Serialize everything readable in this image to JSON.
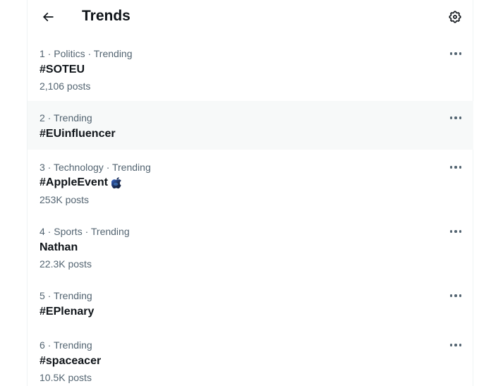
{
  "header": {
    "title": "Trends",
    "back_icon": "arrow-left-icon",
    "settings_icon": "gear-icon"
  },
  "trends": [
    {
      "rank_context": "1 · Politics · Trending",
      "name": "#SOTEU",
      "posts": "2,106 posts"
    },
    {
      "rank_context": "2 · Trending",
      "name": "#EUinfluencer",
      "posts": ""
    },
    {
      "rank_context": "3 · Technology · Trending",
      "name": "#AppleEvent",
      "posts": "253K posts",
      "emoji_icon": "apple-event-icon"
    },
    {
      "rank_context": "4 · Sports · Trending",
      "name": "Nathan",
      "posts": "22.3K posts"
    },
    {
      "rank_context": "5 · Trending",
      "name": "#EPlenary",
      "posts": ""
    },
    {
      "rank_context": "6 · Trending",
      "name": "#spaceacer",
      "posts": "10.5K posts"
    }
  ],
  "more_icon": "more-horizontal-icon",
  "colors": {
    "text_primary": "#0f1419",
    "text_secondary": "#536471",
    "hover_background": "#f7f9f9"
  }
}
